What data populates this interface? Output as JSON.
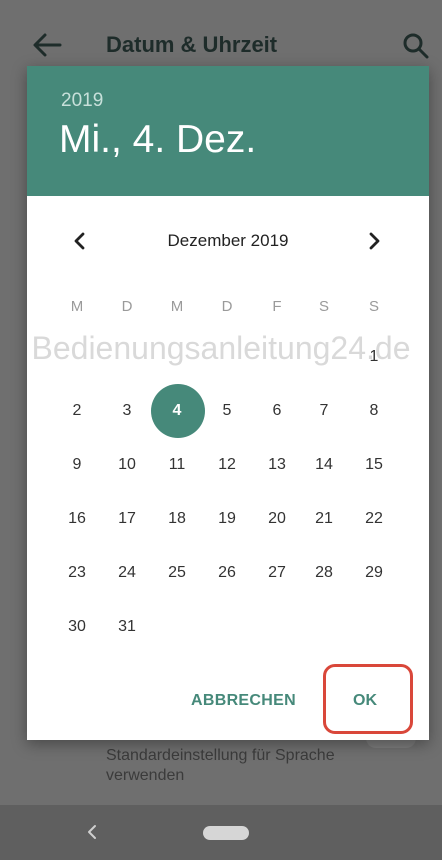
{
  "app_bar": {
    "title": "Datum & Uhrzeit",
    "back_icon": "arrow-left-icon",
    "search_icon": "search-icon"
  },
  "background": {
    "setting_subtitle": "Standardeinstellung für Sprache verwenden"
  },
  "dialog": {
    "header": {
      "year": "2019",
      "date": "Mi., 4. Dez."
    },
    "month_label": "Dezember 2019",
    "prev_icon": "chevron-left-icon",
    "next_icon": "chevron-right-icon",
    "weekdays": [
      "M",
      "D",
      "M",
      "D",
      "F",
      "S",
      "S"
    ],
    "weeks": [
      [
        "",
        "",
        "",
        "",
        "",
        "",
        "1"
      ],
      [
        "2",
        "3",
        "4",
        "5",
        "6",
        "7",
        "8"
      ],
      [
        "9",
        "10",
        "11",
        "12",
        "13",
        "14",
        "15"
      ],
      [
        "16",
        "17",
        "18",
        "19",
        "20",
        "21",
        "22"
      ],
      [
        "23",
        "24",
        "25",
        "26",
        "27",
        "28",
        "29"
      ],
      [
        "30",
        "31",
        "",
        "",
        "",
        "",
        ""
      ]
    ],
    "selected_day": "4",
    "cancel_label": "ABBRECHEN",
    "ok_label": "OK"
  },
  "watermark": "Bedienungsanleitung24.de",
  "colors": {
    "accent": "#46897a",
    "highlight": "#d9473a"
  },
  "nav": {
    "back_icon": "nav-back-icon",
    "home_icon": "nav-home-pill-icon"
  }
}
